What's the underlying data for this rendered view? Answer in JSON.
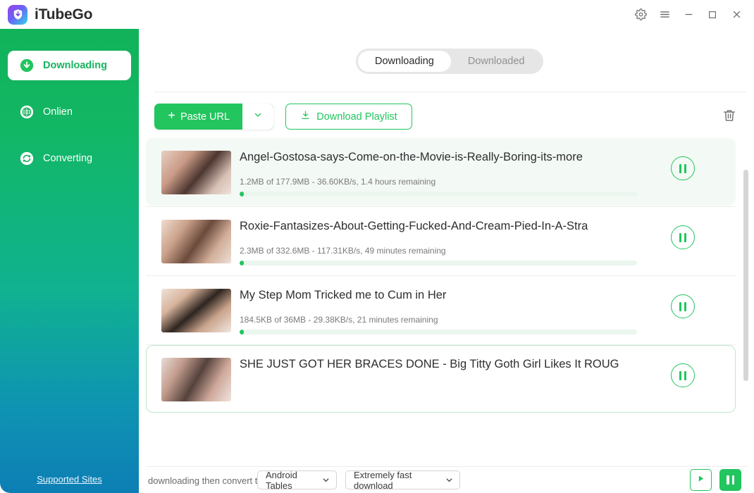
{
  "window": {
    "title": "iTubeGo",
    "logo_icon": "shield-download-icon",
    "controls": [
      {
        "name": "settings-button",
        "icon": "gear-icon"
      },
      {
        "name": "menu-button",
        "icon": "hamburger-menu-icon"
      },
      {
        "name": "minimize-button",
        "icon": "minimize-icon"
      },
      {
        "name": "maximize-button",
        "icon": "maximize-icon"
      },
      {
        "name": "close-button",
        "icon": "close-icon"
      }
    ]
  },
  "sidebar": {
    "gradient_from": "#11b259",
    "gradient_to": "#0d7eb4",
    "items": [
      {
        "label": "Downloading",
        "icon": "download-circle-icon",
        "active": true
      },
      {
        "label": "Onlien",
        "icon": "globe-icon",
        "active": false
      },
      {
        "label": "Converting",
        "icon": "refresh-circle-icon",
        "active": false
      }
    ],
    "footer_link": "Supported Sites"
  },
  "main": {
    "tabs": [
      {
        "label": "Downloading",
        "active": true
      },
      {
        "label": "Downloaded",
        "active": false
      }
    ],
    "toolbar": {
      "paste_url_label": "Paste URL",
      "paste_url_icon": "plus-icon",
      "paste_url_caret_icon": "chevron-down-icon",
      "download_playlist_label": "Download Playlist",
      "download_playlist_icon": "download-icon",
      "delete_icon": "trash-icon",
      "accent_color": "#22c55e"
    },
    "downloads": [
      {
        "title": "Angel-Gostosa-says-Come-on-the-Movie-is-Really-Boring-its-more",
        "stats": "1.2MB of 177.9MB -  36.60KB/s, 1.4 hours remaining",
        "progress_percent": 1,
        "action_icon": "pause-icon",
        "selected": true
      },
      {
        "title": "Roxie-Fantasizes-About-Getting-Fucked-And-Cream-Pied-In-A-Stra",
        "stats": "2.3MB of 332.6MB -  117.31KB/s, 49 minutes remaining",
        "progress_percent": 1,
        "action_icon": "pause-icon",
        "selected": false
      },
      {
        "title": "My Step Mom Tricked me to Cum in Her",
        "stats": "184.5KB of 36MB -  29.38KB/s, 21 minutes remaining",
        "progress_percent": 1,
        "action_icon": "pause-icon",
        "selected": false
      },
      {
        "title": "SHE JUST GOT HER BRACES DONE - Big Titty Goth Girl Likes It ROUG",
        "stats": "",
        "progress_percent": 0,
        "action_icon": "pause-icon",
        "selected": false
      }
    ],
    "footer": {
      "convert_label": "downloading then convert to:",
      "format_value": "Android Tables",
      "speed_value": "Extremely fast download",
      "caret_icon": "chevron-down-icon",
      "start_icon": "play-icon",
      "pause_all_icon": "pause-icon"
    }
  }
}
